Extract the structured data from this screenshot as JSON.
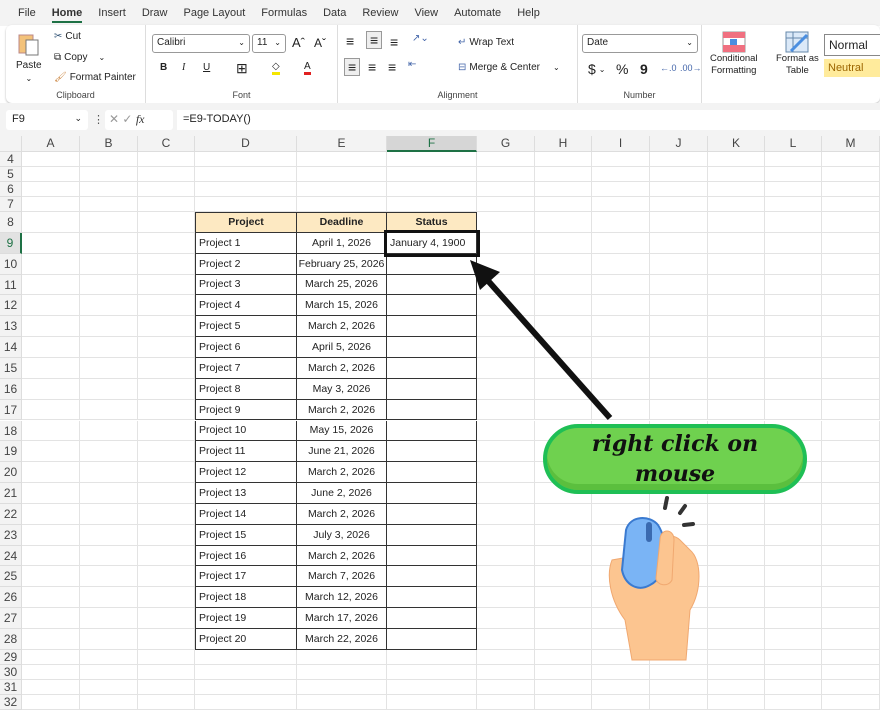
{
  "menu_tabs": [
    "File",
    "Home",
    "Insert",
    "Draw",
    "Page Layout",
    "Formulas",
    "Data",
    "Review",
    "View",
    "Automate",
    "Help"
  ],
  "active_tab": "Home",
  "ribbon": {
    "clipboard": {
      "label": "Clipboard",
      "paste": "Paste",
      "cut": "Cut",
      "copy": "Copy",
      "format_painter": "Format Painter"
    },
    "font": {
      "label": "Font",
      "name": "Calibri",
      "size": "11",
      "bold": "B",
      "italic": "I",
      "underline": "U"
    },
    "alignment": {
      "label": "Alignment",
      "wrap": "Wrap Text",
      "merge": "Merge & Center"
    },
    "number": {
      "label": "Number",
      "format": "Date",
      "currency": "$",
      "percent": "%",
      "comma": "9"
    },
    "styles": {
      "conditional": "Conditional",
      "formatting": "Formatting",
      "format_as": "Format as",
      "table": "Table",
      "normal": "Normal",
      "neutral": "Neutral"
    }
  },
  "formula_bar": {
    "name_box": "F9",
    "fx": "fx",
    "formula": "=E9-TODAY()"
  },
  "columns": [
    "A",
    "B",
    "C",
    "D",
    "E",
    "F",
    "G",
    "H",
    "I",
    "J",
    "K",
    "L",
    "M"
  ],
  "rows": [
    4,
    5,
    6,
    7,
    8,
    9,
    10,
    11,
    12,
    13,
    14,
    15,
    16,
    17,
    18,
    19,
    20,
    21,
    22,
    23,
    24,
    25,
    26,
    27,
    28,
    29,
    30,
    31,
    32
  ],
  "selected_cell": "F9",
  "table": {
    "headers": [
      "Project",
      "Deadline",
      "Status"
    ],
    "rows": [
      [
        "Project 1",
        "April 1, 2026",
        "January 4, 1900"
      ],
      [
        "Project 2",
        "February 25, 2026",
        ""
      ],
      [
        "Project 3",
        "March 25, 2026",
        ""
      ],
      [
        "Project 4",
        "March 15, 2026",
        ""
      ],
      [
        "Project 5",
        "March 2, 2026",
        ""
      ],
      [
        "Project 6",
        "April 5, 2026",
        ""
      ],
      [
        "Project 7",
        "March 2, 2026",
        ""
      ],
      [
        "Project 8",
        "May 3, 2026",
        ""
      ],
      [
        "Project 9",
        "March 2, 2026",
        ""
      ],
      [
        "Project 10",
        "May 15, 2026",
        ""
      ],
      [
        "Project 11",
        "June 21, 2026",
        ""
      ],
      [
        "Project 12",
        "March 2, 2026",
        ""
      ],
      [
        "Project 13",
        "June 2, 2026",
        ""
      ],
      [
        "Project 14",
        "March 2, 2026",
        ""
      ],
      [
        "Project 15",
        "July 3, 2026",
        ""
      ],
      [
        "Project 16",
        "March 2, 2026",
        ""
      ],
      [
        "Project 17",
        "March 7, 2026",
        ""
      ],
      [
        "Project 18",
        "March 12, 2026",
        ""
      ],
      [
        "Project 19",
        "March 17, 2026",
        ""
      ],
      [
        "Project 20",
        "March 22, 2026",
        ""
      ]
    ]
  },
  "callout": {
    "line1": "right click on",
    "line2": "mouse"
  },
  "colors": {
    "header_fill": "#fde9c2",
    "bubble": "#6fd14f",
    "accent": "#1e7145"
  }
}
